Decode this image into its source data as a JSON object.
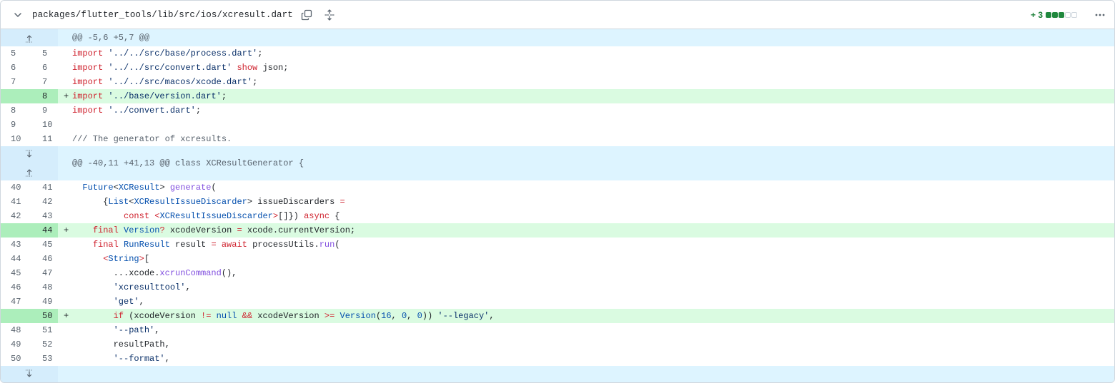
{
  "file": {
    "path": "packages/flutter_tools/lib/src/ios/xcresult.dart",
    "additions": "+ 3",
    "diffstat": [
      "add",
      "add",
      "add",
      "neutral",
      "neutral"
    ]
  },
  "icons": {
    "collapse": "chevron-down-icon",
    "copy": "copy-icon",
    "expand_all": "unfold-icon",
    "more": "kebab-horizontal-icon",
    "expand_up": "fold-up-icon",
    "expand_down": "fold-down-icon"
  },
  "colors": {
    "hunk_bg": "#ddf4ff",
    "add_bg": "#dafbe1",
    "add_num_bg": "#aceebb",
    "addition_text": "#1a7f37"
  },
  "hunks": [
    {
      "header": "@@ -5,6 +5,7 @@"
    },
    {
      "header": "@@ -40,11 +41,13 @@ class XCResultGenerator {"
    }
  ],
  "lines": [
    {
      "old": "5",
      "new": "5",
      "marker": "",
      "tokens": [
        [
          "kw",
          "import"
        ],
        [
          "pl",
          " "
        ],
        [
          "str",
          "'../../src/base/process.dart'"
        ],
        [
          "pl",
          ";"
        ]
      ]
    },
    {
      "old": "6",
      "new": "6",
      "marker": "",
      "tokens": [
        [
          "kw",
          "import"
        ],
        [
          "pl",
          " "
        ],
        [
          "str",
          "'../../src/convert.dart'"
        ],
        [
          "pl",
          " "
        ],
        [
          "kw",
          "show"
        ],
        [
          "pl",
          " json;"
        ]
      ]
    },
    {
      "old": "7",
      "new": "7",
      "marker": "",
      "tokens": [
        [
          "kw",
          "import"
        ],
        [
          "pl",
          " "
        ],
        [
          "str",
          "'../../src/macos/xcode.dart'"
        ],
        [
          "pl",
          ";"
        ]
      ]
    },
    {
      "old": "",
      "new": "8",
      "marker": "+",
      "tokens": [
        [
          "kw",
          "import"
        ],
        [
          "pl",
          " "
        ],
        [
          "str",
          "'../base/version.dart'"
        ],
        [
          "pl",
          ";"
        ]
      ]
    },
    {
      "old": "8",
      "new": "9",
      "marker": "",
      "tokens": [
        [
          "kw",
          "import"
        ],
        [
          "pl",
          " "
        ],
        [
          "str",
          "'../convert.dart'"
        ],
        [
          "pl",
          ";"
        ]
      ]
    },
    {
      "old": "9",
      "new": "10",
      "marker": "",
      "tokens": [
        [
          "pl",
          ""
        ]
      ]
    },
    {
      "old": "10",
      "new": "11",
      "marker": "",
      "tokens": [
        [
          "cm",
          "/// The generator of xcresults."
        ]
      ]
    },
    {
      "old": "40",
      "new": "41",
      "marker": "",
      "tokens": [
        [
          "pl",
          "  "
        ],
        [
          "ty",
          "Future"
        ],
        [
          "pl",
          "<"
        ],
        [
          "ty",
          "XCResult"
        ],
        [
          "pl",
          "> "
        ],
        [
          "fn",
          "generate"
        ],
        [
          "pl",
          "("
        ]
      ]
    },
    {
      "old": "41",
      "new": "42",
      "marker": "",
      "tokens": [
        [
          "pl",
          "      {"
        ],
        [
          "ty",
          "List"
        ],
        [
          "pl",
          "<"
        ],
        [
          "ty",
          "XCResultIssueDiscarder"
        ],
        [
          "pl",
          "> issueDiscarders "
        ],
        [
          "kw",
          "="
        ]
      ]
    },
    {
      "old": "42",
      "new": "43",
      "marker": "",
      "tokens": [
        [
          "pl",
          "          "
        ],
        [
          "kw",
          "const"
        ],
        [
          "pl",
          " "
        ],
        [
          "kw",
          "<"
        ],
        [
          "ty",
          "XCResultIssueDiscarder"
        ],
        [
          "kw",
          ">"
        ],
        [
          "pl",
          "[]}) "
        ],
        [
          "kw",
          "async"
        ],
        [
          "pl",
          " {"
        ]
      ]
    },
    {
      "old": "",
      "new": "44",
      "marker": "+",
      "tokens": [
        [
          "pl",
          "    "
        ],
        [
          "kw",
          "final"
        ],
        [
          "pl",
          " "
        ],
        [
          "ty",
          "Version"
        ],
        [
          "kw",
          "?"
        ],
        [
          "pl",
          " xcodeVersion "
        ],
        [
          "kw",
          "="
        ],
        [
          "pl",
          " xcode.currentVersion;"
        ]
      ]
    },
    {
      "old": "43",
      "new": "45",
      "marker": "",
      "tokens": [
        [
          "pl",
          "    "
        ],
        [
          "kw",
          "final"
        ],
        [
          "pl",
          " "
        ],
        [
          "ty",
          "RunResult"
        ],
        [
          "pl",
          " result "
        ],
        [
          "kw",
          "="
        ],
        [
          "pl",
          " "
        ],
        [
          "kw",
          "await"
        ],
        [
          "pl",
          " processUtils."
        ],
        [
          "fn",
          "run"
        ],
        [
          "pl",
          "("
        ]
      ]
    },
    {
      "old": "44",
      "new": "46",
      "marker": "",
      "tokens": [
        [
          "pl",
          "      "
        ],
        [
          "kw",
          "<"
        ],
        [
          "ty",
          "String"
        ],
        [
          "kw",
          ">"
        ],
        [
          "pl",
          "["
        ]
      ]
    },
    {
      "old": "45",
      "new": "47",
      "marker": "",
      "tokens": [
        [
          "pl",
          "        ...xcode."
        ],
        [
          "fn",
          "xcrunCommand"
        ],
        [
          "pl",
          "(),"
        ]
      ]
    },
    {
      "old": "46",
      "new": "48",
      "marker": "",
      "tokens": [
        [
          "pl",
          "        "
        ],
        [
          "str",
          "'xcresulttool'"
        ],
        [
          "pl",
          ","
        ]
      ]
    },
    {
      "old": "47",
      "new": "49",
      "marker": "",
      "tokens": [
        [
          "pl",
          "        "
        ],
        [
          "str",
          "'get'"
        ],
        [
          "pl",
          ","
        ]
      ]
    },
    {
      "old": "",
      "new": "50",
      "marker": "+",
      "tokens": [
        [
          "pl",
          "        "
        ],
        [
          "kw",
          "if"
        ],
        [
          "pl",
          " (xcodeVersion "
        ],
        [
          "kw",
          "!="
        ],
        [
          "pl",
          " "
        ],
        [
          "ty",
          "null"
        ],
        [
          "pl",
          " "
        ],
        [
          "kw",
          "&&"
        ],
        [
          "pl",
          " xcodeVersion "
        ],
        [
          "kw",
          ">="
        ],
        [
          "pl",
          " "
        ],
        [
          "ty",
          "Version"
        ],
        [
          "pl",
          "("
        ],
        [
          "ty",
          "16"
        ],
        [
          "pl",
          ", "
        ],
        [
          "ty",
          "0"
        ],
        [
          "pl",
          ", "
        ],
        [
          "ty",
          "0"
        ],
        [
          "pl",
          ")) "
        ],
        [
          "str",
          "'--legacy'"
        ],
        [
          "pl",
          ","
        ]
      ]
    },
    {
      "old": "48",
      "new": "51",
      "marker": "",
      "tokens": [
        [
          "pl",
          "        "
        ],
        [
          "str",
          "'--path'"
        ],
        [
          "pl",
          ","
        ]
      ]
    },
    {
      "old": "49",
      "new": "52",
      "marker": "",
      "tokens": [
        [
          "pl",
          "        resultPath,"
        ]
      ]
    },
    {
      "old": "50",
      "new": "53",
      "marker": "",
      "tokens": [
        [
          "pl",
          "        "
        ],
        [
          "str",
          "'--format'"
        ],
        [
          "pl",
          ","
        ]
      ]
    }
  ]
}
